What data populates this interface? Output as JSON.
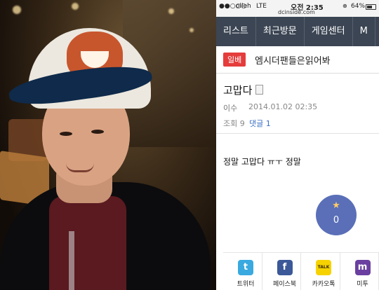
{
  "status_bar": {
    "signal": "●●○○○",
    "carrier": "olleh",
    "network": "LTE",
    "time": "오전 2:35",
    "url": "dcinside.com",
    "alarm": "⊕",
    "battery_pct": "64%"
  },
  "nav": {
    "tabs": [
      {
        "label": "리스트"
      },
      {
        "label": "최근방문"
      },
      {
        "label": "게임센터"
      },
      {
        "label": "M"
      }
    ]
  },
  "board": {
    "badge": "일베",
    "name": "엠시더팬들은읽어봐"
  },
  "post": {
    "title": "고맙다",
    "author": "이수",
    "date": "2014.01.02 02:35",
    "views": "조회 9",
    "comments": "댓글 1",
    "content": "정말 고맙다 ㅠㅜ 정말"
  },
  "recommend": {
    "count": "0"
  },
  "share": [
    {
      "label": "트위터",
      "icon": "twitter-icon",
      "glyph": "t",
      "color": "#39a9e0"
    },
    {
      "label": "페이스북",
      "icon": "facebook-icon",
      "glyph": "f",
      "color": "#3b5998"
    },
    {
      "label": "카카오톡",
      "icon": "kakaotalk-icon",
      "glyph": "TALK",
      "color": "#f6d300"
    },
    {
      "label": "미투",
      "icon": "me2day-icon",
      "glyph": "m",
      "color": "#6a3fa0"
    }
  ]
}
